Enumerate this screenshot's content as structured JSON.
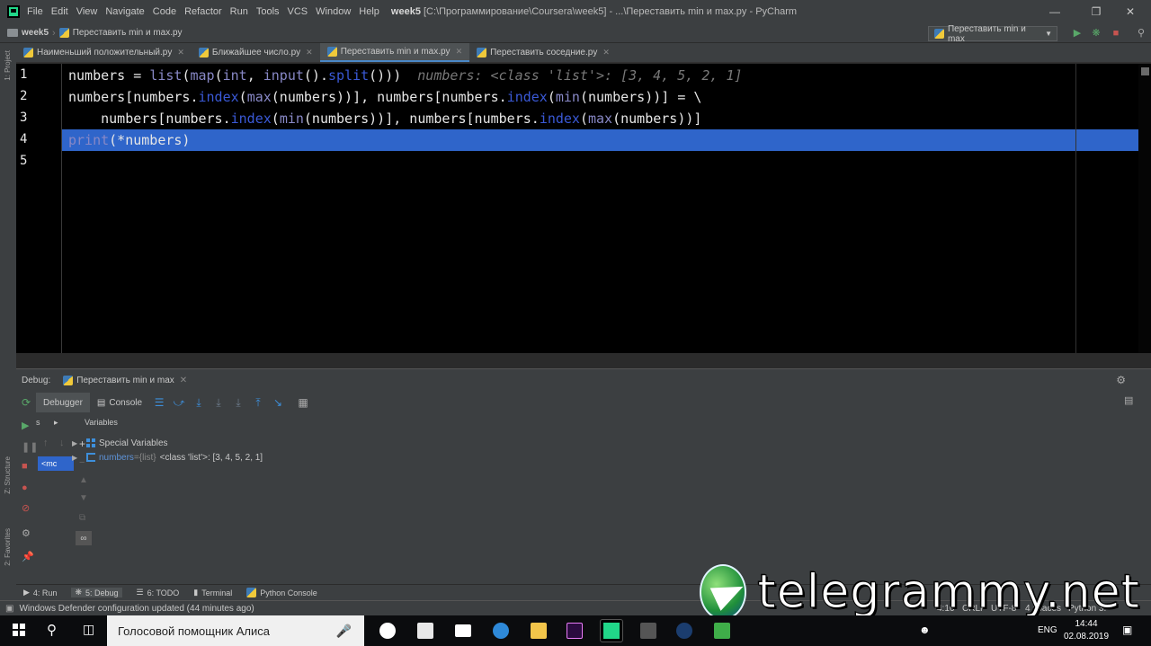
{
  "menubar": {
    "items": [
      "File",
      "Edit",
      "View",
      "Navigate",
      "Code",
      "Refactor",
      "Run",
      "Tools",
      "VCS",
      "Window",
      "Help"
    ],
    "project": "week5",
    "title_rest": "[C:\\Программирование\\Coursera\\week5] - ...\\Переставить min и max.py - PyCharm"
  },
  "navbar": {
    "project": "week5",
    "file": "Переставить min и max.py",
    "run_config": "Переставить min и max"
  },
  "left_strip": {
    "project": "1: Project",
    "structure": "Z: Structure",
    "favorites": "2: Favorites"
  },
  "tabs": [
    "Наименьший положительный.py",
    "Ближайшее число.py",
    "Переставить min и max.py",
    "Переставить соседние.py"
  ],
  "editor": {
    "line_numbers": [
      "1",
      "2",
      "3",
      "4",
      "5"
    ],
    "line1": {
      "t1": "numbers = ",
      "t2": "list",
      "t3": "(",
      "t4": "map",
      "t5": "(",
      "t6": "int",
      "t7": ", ",
      "t8": "input",
      "t9": "().",
      "t10": "split",
      "t11": "()))",
      "hint": "numbers: <class 'list'>: [3, 4, 5, 2, 1]"
    },
    "line2": {
      "t1": "numbers[numbers.",
      "t2": "index",
      "t3": "(",
      "t4": "max",
      "t5": "(numbers))], numbers[numbers.",
      "t6": "index",
      "t7": "(",
      "t8": "min",
      "t9": "(numbers))] = \\"
    },
    "line3": {
      "t1": "    numbers[numbers.",
      "t2": "index",
      "t3": "(",
      "t4": "min",
      "t5": "(numbers))], numbers[numbers.",
      "t6": "index",
      "t7": "(",
      "t8": "max",
      "t9": "(numbers))]"
    },
    "line4": {
      "t1": "print",
      "t2": "(*numbers)"
    }
  },
  "debug": {
    "label": "Debug:",
    "session": "Переставить min и max",
    "tabs": {
      "debugger": "Debugger",
      "console": "Console"
    },
    "frames_short": "s",
    "threads_short": "▸",
    "variables_header": "Variables",
    "frame_selected": "<mc",
    "vars": {
      "special": "Special Variables",
      "name": "numbers",
      "equals": " = ",
      "type": "{list}",
      "value": "<class 'list'>: [3, 4, 5, 2, 1]"
    }
  },
  "toolwindows": {
    "run": "4: Run",
    "debug": "5: Debug",
    "todo": "6: TODO",
    "terminal": "Terminal",
    "python_console": "Python Console"
  },
  "status": {
    "message": "Windows Defender configuration updated (44 minutes ago)",
    "position": "4:16",
    "line_sep": "CRLF",
    "encoding": "UTF-8",
    "indent": "4 spaces",
    "interpreter": "Python 3."
  },
  "taskbar": {
    "search": "Голосовой помощник Алиса",
    "lang": "ENG",
    "time": "14:44",
    "date": "02.08.2019"
  },
  "watermark": "telegrammy.net"
}
